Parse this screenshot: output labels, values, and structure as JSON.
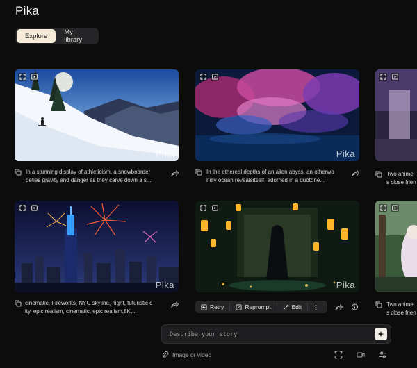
{
  "app": {
    "logo": "Pika"
  },
  "tabs": [
    {
      "label": "Explore",
      "active": true
    },
    {
      "label": "My library",
      "active": false
    }
  ],
  "cards": [
    {
      "caption_1": "In a stunning display of athleticism, a snowboarder",
      "caption_2": "defies gravity and danger as they carve down a s...",
      "watermark": "Pika"
    },
    {
      "caption_1": "In the ethereal depths of an alien abyss, an otherwo",
      "caption_2": "rldly ocean revealsitself, adorned in a duotone...",
      "watermark": "Pika"
    },
    {
      "caption_1": "Two anime",
      "caption_2": "s close frien",
      "watermark": ""
    },
    {
      "caption_1": "cinematic, Fireworks, NYC skyline, night, futuristic c",
      "caption_2": "ity, epic realism, cinematic, epic realism,8K,...",
      "watermark": "Pika"
    },
    {
      "caption_1": "",
      "caption_2": "",
      "watermark": "Pika"
    },
    {
      "caption_1": "Two anime",
      "caption_2": "s close frien",
      "watermark": ""
    }
  ],
  "actions": {
    "retry": "Retry",
    "reprompt": "Reprompt",
    "edit": "Edit"
  },
  "prompt": {
    "placeholder": "Describe your story",
    "value": ""
  },
  "attach": {
    "label": "Image or video"
  },
  "colors": {
    "accent": "#f6ead8",
    "background": "#0c0c0d"
  }
}
